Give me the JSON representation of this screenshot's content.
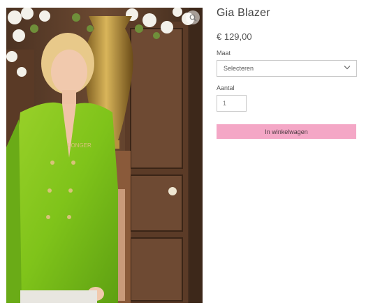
{
  "product": {
    "name": "Gia Blazer",
    "price": "€ 129,00",
    "image_alt": "Woman wearing a lime green velvet double-breasted blazer",
    "image_label_text": "LONGER"
  },
  "size": {
    "label": "Maat",
    "selected": "Selecteren"
  },
  "quantity": {
    "label": "Aantal",
    "value": "1"
  },
  "cart": {
    "button_label": "In winkelwagen",
    "accent_color": "#f4a7c6"
  },
  "icons": {
    "zoom": "zoom-icon",
    "select_chevron": "chevron-down-icon"
  }
}
